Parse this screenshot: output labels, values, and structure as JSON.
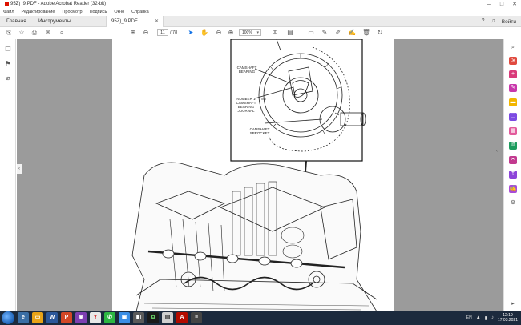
{
  "window": {
    "title": "95Z)_9.PDF - Adobe Acrobat Reader (32-bit)",
    "minimize_icon": "minimize-icon",
    "maximize_icon": "maximize-icon",
    "close_icon": "close-icon"
  },
  "menu": [
    "Файл",
    "Редактирование",
    "Просмотр",
    "Подпись",
    "Окно",
    "Справка"
  ],
  "tabs": {
    "home": "Главная",
    "tools": "Инструменты",
    "document": "95Z)_9.PDF",
    "signin": "Войти"
  },
  "toolbar": {
    "page_current": "11",
    "page_total": "/  78",
    "zoom": "100%"
  },
  "figure": {
    "labels": {
      "camshaft_bearing": "CAMSHAFT\nBEARING",
      "bearing_journal": "NUMBER 1\nCAMSHAFT\nBEARING\nJOURNAL",
      "camshaft_sprocket": "CAMSHAFT\nSPROCKET"
    }
  },
  "taskbar": {
    "language": "EN",
    "time": "12:19",
    "date": "17.03.2021"
  },
  "colors": {
    "doc_background": "#9b9b9b",
    "taskbar": "#1c2a3d",
    "accent": "#1473e6"
  }
}
